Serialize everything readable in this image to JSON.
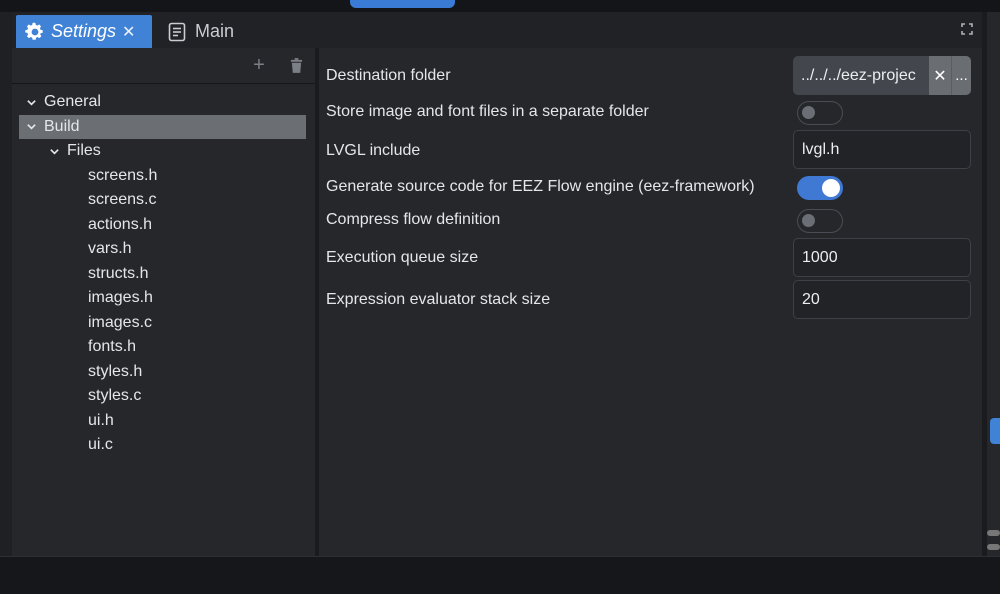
{
  "tabs": {
    "settings_label": "Settings",
    "main_label": "Main"
  },
  "tree": [
    {
      "label": "General",
      "level": 0,
      "expanded": true,
      "selected": false
    },
    {
      "label": "Build",
      "level": 0,
      "expanded": true,
      "selected": true
    },
    {
      "label": "Files",
      "level": 1,
      "expanded": true,
      "selected": false
    },
    {
      "label": "screens.h",
      "level": 2
    },
    {
      "label": "screens.c",
      "level": 2
    },
    {
      "label": "actions.h",
      "level": 2
    },
    {
      "label": "vars.h",
      "level": 2
    },
    {
      "label": "structs.h",
      "level": 2
    },
    {
      "label": "images.h",
      "level": 2
    },
    {
      "label": "images.c",
      "level": 2
    },
    {
      "label": "fonts.h",
      "level": 2
    },
    {
      "label": "styles.h",
      "level": 2
    },
    {
      "label": "styles.c",
      "level": 2
    },
    {
      "label": "ui.h",
      "level": 2
    },
    {
      "label": "ui.c",
      "level": 2
    }
  ],
  "properties": {
    "destination_folder": {
      "label": "Destination folder",
      "value": "../../../eez-projec",
      "clear": "✕",
      "browse": "..."
    },
    "separate_folder": {
      "label": "Store image and font files in a separate folder",
      "checked": false
    },
    "lvgl_include": {
      "label": "LVGL include",
      "value": "lvgl.h"
    },
    "flow_engine": {
      "label": "Generate source code for EEZ Flow engine (eez-framework)",
      "checked": true
    },
    "compress_flow": {
      "label": "Compress flow definition",
      "checked": false
    },
    "queue_size": {
      "label": "Execution queue size",
      "value": "1000"
    },
    "stack_size": {
      "label": "Expression evaluator stack size",
      "value": "20"
    }
  },
  "colors": {
    "accent": "#3f82d6",
    "toggle_on": "#3f79d4",
    "selected_row": "#6b6e73",
    "panel_bg": "#25272b"
  },
  "icons": {
    "settings_tab": "gear-icon",
    "main_tab": "document-icon",
    "add": "plus-icon",
    "delete": "trash-icon",
    "expand": "expand-icon"
  }
}
